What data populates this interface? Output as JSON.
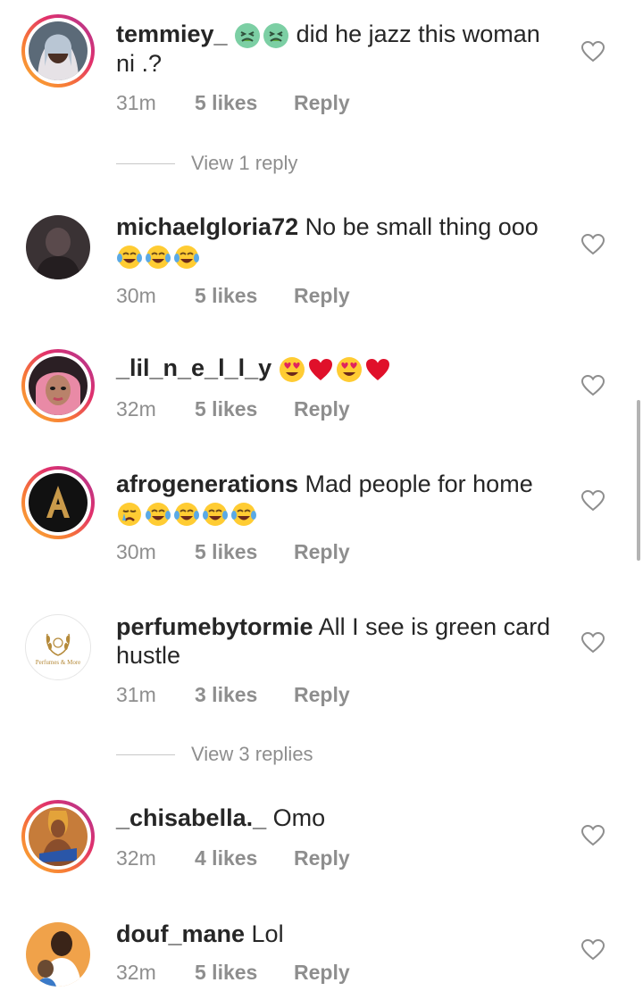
{
  "comments": [
    {
      "username": "temmiey_",
      "text": " did he jazz this woman ni .?",
      "pre_emojis": [
        "nauseated-face",
        "nauseated-face"
      ],
      "post_emojis": [],
      "time": "31m",
      "likes": "5 likes",
      "reply": "Reply",
      "story_ring": true
    },
    {
      "username": "michaelgloria72",
      "text": " No be small thing ooo",
      "pre_emojis": [],
      "post_emojis": [
        "tears-of-joy",
        "tears-of-joy",
        "tears-of-joy"
      ],
      "time": "30m",
      "likes": "5 likes",
      "reply": "Reply",
      "story_ring": false
    },
    {
      "username": "_lil_n_e_l_l_y",
      "text": "",
      "pre_emojis": [],
      "post_emojis": [
        "heart-eyes",
        "red-heart",
        "heart-eyes",
        "red-heart"
      ],
      "time": "32m",
      "likes": "5 likes",
      "reply": "Reply",
      "story_ring": true
    },
    {
      "username": "afrogenerations",
      "text": " Mad people for home",
      "pre_emojis": [],
      "post_emojis": [
        "crying-face",
        "tears-of-joy",
        "tears-of-joy",
        "tears-of-joy",
        "tears-of-joy"
      ],
      "time": "30m",
      "likes": "5 likes",
      "reply": "Reply",
      "story_ring": true
    },
    {
      "username": "perfumebytormie",
      "text": " All I see is green card hustle",
      "pre_emojis": [],
      "post_emojis": [],
      "time": "31m",
      "likes": "3 likes",
      "reply": "Reply",
      "story_ring": false,
      "avatar_text": "Perfumes & More"
    },
    {
      "username": "_chisabella._",
      "text": " Omo",
      "pre_emojis": [],
      "post_emojis": [],
      "time": "32m",
      "likes": "4 likes",
      "reply": "Reply",
      "story_ring": true
    },
    {
      "username": "douf_mane",
      "text": " Lol",
      "pre_emojis": [],
      "post_emojis": [],
      "time": "32m",
      "likes": "5 likes",
      "reply": "Reply",
      "story_ring": false
    }
  ],
  "view_replies": [
    {
      "label": "View 1 reply"
    },
    {
      "label": "View 3 replies"
    }
  ],
  "colors": {
    "text": "#262626",
    "meta": "#8e8e8e",
    "story_ring": "#e1306c"
  },
  "icons": {
    "like": "heart-outline-icon"
  }
}
